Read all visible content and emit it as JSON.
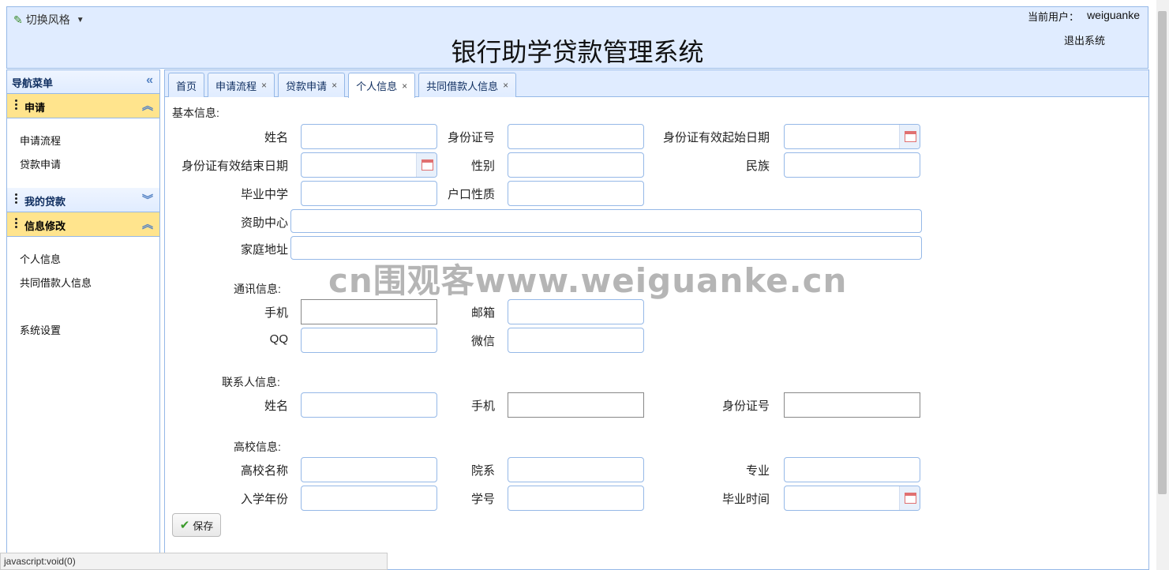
{
  "header": {
    "theme_switch": "切换风格",
    "title": "银行助学贷款管理系统",
    "user_label": "当前用户：",
    "username": "weiguanke",
    "logout": "退出系统"
  },
  "sidebar": {
    "nav_title": "导航菜单",
    "groups": [
      {
        "title": "申请",
        "items": [
          "申请流程",
          "贷款申请"
        ]
      },
      {
        "title": "我的贷款",
        "items": []
      },
      {
        "title": "信息修改",
        "items": [
          "个人信息",
          "共同借款人信息",
          "系统设置"
        ]
      }
    ]
  },
  "tabs": [
    {
      "label": "首页",
      "closable": false
    },
    {
      "label": "申请流程",
      "closable": true
    },
    {
      "label": "贷款申请",
      "closable": true
    },
    {
      "label": "个人信息",
      "closable": true,
      "active": true
    },
    {
      "label": "共同借款人信息",
      "closable": true
    }
  ],
  "close_glyph": "×",
  "form": {
    "basic_title": "基本信息:",
    "name": "姓名",
    "id_number": "身份证号",
    "id_valid_start": "身份证有效起始日期",
    "id_valid_end": "身份证有效结束日期",
    "gender": "性别",
    "ethnicity": "民族",
    "high_school": "毕业中学",
    "household_type": "户口性质",
    "aid_center": "资助中心",
    "home_address": "家庭地址",
    "contact_title": "通讯信息:",
    "mobile": "手机",
    "email": "邮箱",
    "qq": "QQ",
    "wechat": "微信",
    "liaison_title": "联系人信息:",
    "liaison_name": "姓名",
    "liaison_mobile": "手机",
    "liaison_id": "身份证号",
    "college_title": "高校信息:",
    "college_name": "高校名称",
    "department": "院系",
    "major": "专业",
    "enroll_year": "入学年份",
    "student_no": "学号",
    "graduation_time": "毕业时间",
    "save": "保存"
  },
  "watermark": "cn围观客www.weiguanke.cn",
  "status_text": "javascript:void(0)"
}
